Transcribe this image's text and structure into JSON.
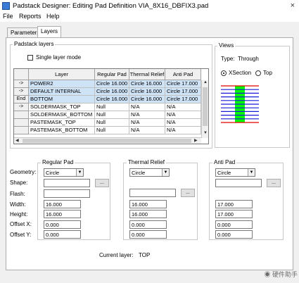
{
  "window": {
    "title": "Padstack Designer: Editing Pad Definition VIA_8X16_DBFIX3.pad",
    "close_glyph": "×"
  },
  "menu": {
    "items": [
      "File",
      "Reports",
      "Help"
    ]
  },
  "tabs": [
    "Parameters",
    "Layers"
  ],
  "layers_group": {
    "label": "Padstack layers",
    "single_layer_mode": "Single layer mode",
    "columns": [
      "Layer",
      "Regular Pad",
      "Thermal Relief",
      "Anti Pad"
    ],
    "rows": [
      {
        "marker": "->",
        "layer": "POWER2",
        "regular": "Circle 16.000",
        "thermal": "Circle 16.000",
        "anti": "Circle 17.000",
        "selected": true
      },
      {
        "marker": "->",
        "layer": "DEFAULT INTERNAL",
        "regular": "Circle 16.000",
        "thermal": "Circle 16.000",
        "anti": "Circle 17.000",
        "selected": true
      },
      {
        "marker": "End",
        "layer": "BOTTOM",
        "regular": "Circle 16.000",
        "thermal": "Circle 16.000",
        "anti": "Circle 17.000",
        "selected": true
      },
      {
        "marker": "->",
        "layer": "SOLDERMASK_TOP",
        "regular": "Null",
        "thermal": "N/A",
        "anti": "N/A",
        "selected": false
      },
      {
        "marker": "",
        "layer": "SOLDERMASK_BOTTOM",
        "regular": "Null",
        "thermal": "N/A",
        "anti": "N/A",
        "selected": false
      },
      {
        "marker": "",
        "layer": "PASTEMASK_TOP",
        "regular": "Null",
        "thermal": "N/A",
        "anti": "N/A",
        "selected": false
      },
      {
        "marker": "",
        "layer": "PASTEMASK_BOTTOM",
        "regular": "Null",
        "thermal": "N/A",
        "anti": "N/A",
        "selected": false
      }
    ]
  },
  "views": {
    "label": "Views",
    "type_label": "Type:",
    "type_value": "Through",
    "xsection": "XSection",
    "top": "Top"
  },
  "form": {
    "geometry": "Geometry:",
    "shape": "Shape:",
    "flash": "Flash:",
    "width": "Width:",
    "height": "Height:",
    "offset_x": "Offset X:",
    "offset_y": "Offset Y:",
    "browse": "..."
  },
  "regular_pad": {
    "label": "Regular Pad",
    "geometry": "Circle",
    "width": "16.000",
    "height": "16.000",
    "offset_x": "0.000",
    "offset_y": "0.000"
  },
  "thermal_relief": {
    "label": "Thermal Relief",
    "geometry": "Circle",
    "width": "16.000",
    "height": "16.000",
    "offset_x": "0.000",
    "offset_y": "0.000"
  },
  "anti_pad": {
    "label": "Anti Pad",
    "geometry": "Circle",
    "width": "17.000",
    "height": "17.000",
    "offset_x": "0.000",
    "offset_y": "0.000"
  },
  "current_layer": {
    "label": "Current layer:",
    "value": "TOP"
  },
  "watermark": "硬件助手",
  "colors": {
    "pad_fill": "#00ff00",
    "red_line": "#e00000",
    "blue_line": "#1a1ad6",
    "selection": "#cfe3f7"
  }
}
